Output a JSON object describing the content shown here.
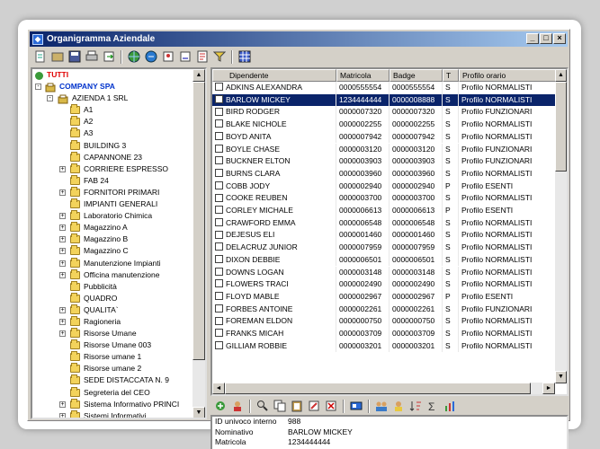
{
  "window": {
    "title": "Organigramma Aziendale"
  },
  "tree": {
    "root": "TUTTI",
    "company": "COMPANY SPA",
    "division": "AZIENDA 1 SRL",
    "nodes": [
      {
        "label": "A1",
        "expandable": false
      },
      {
        "label": "A2",
        "expandable": false
      },
      {
        "label": "A3",
        "expandable": false
      },
      {
        "label": "BUILDING 3",
        "expandable": false
      },
      {
        "label": "CAPANNONE 23",
        "expandable": false
      },
      {
        "label": "CORRIERE ESPRESSO",
        "expandable": true
      },
      {
        "label": "FAB 24",
        "expandable": false
      },
      {
        "label": "FORNITORI PRIMARI",
        "expandable": true
      },
      {
        "label": "IMPIANTI GENERALI",
        "expandable": false
      },
      {
        "label": "Laboratorio Chimica",
        "expandable": true
      },
      {
        "label": "Magazzino A",
        "expandable": true
      },
      {
        "label": "Magazzino B",
        "expandable": true
      },
      {
        "label": "Magazzino C",
        "expandable": true
      },
      {
        "label": "Manutenzione Impianti",
        "expandable": true
      },
      {
        "label": "Officina manutenzione",
        "expandable": true
      },
      {
        "label": "Pubblicità",
        "expandable": false
      },
      {
        "label": "QUADRO",
        "expandable": false
      },
      {
        "label": "QUALITA`",
        "expandable": true
      },
      {
        "label": "Ragioneria",
        "expandable": true
      },
      {
        "label": "Risorse Umane",
        "expandable": true
      },
      {
        "label": "Risorse Umane 003",
        "expandable": false
      },
      {
        "label": "Risorse umane 1",
        "expandable": false
      },
      {
        "label": "Risorse umane 2",
        "expandable": false
      },
      {
        "label": "SEDE DISTACCATA N. 9",
        "expandable": false
      },
      {
        "label": "Segreteria del CEO",
        "expandable": false
      },
      {
        "label": "Sistema Informativo PRINCI",
        "expandable": true
      },
      {
        "label": "Sistemi Informativi",
        "expandable": true
      }
    ]
  },
  "grid": {
    "columns": [
      "Dipendente",
      "Matricola",
      "Badge",
      "T",
      "Profilo orario"
    ],
    "rows": [
      {
        "name": "ADKINS ALEXANDRA",
        "matricola": "0000555554",
        "badge": "0000555554",
        "t": "S",
        "profilo": "Profilo NORMALISTI",
        "selected": false
      },
      {
        "name": "BARLOW MICKEY",
        "matricola": "1234444444",
        "badge": "0000008888",
        "t": "S",
        "profilo": "Profilo NORMALISTI",
        "selected": true
      },
      {
        "name": "BIRD RODGER",
        "matricola": "0000007320",
        "badge": "0000007320",
        "t": "S",
        "profilo": "Profilo FUNZIONARI",
        "selected": false
      },
      {
        "name": "BLAKE NICHOLE",
        "matricola": "0000002255",
        "badge": "0000002255",
        "t": "S",
        "profilo": "Profilo NORMALISTI",
        "selected": false
      },
      {
        "name": "BOYD ANITA",
        "matricola": "0000007942",
        "badge": "0000007942",
        "t": "S",
        "profilo": "Profilo NORMALISTI",
        "selected": false
      },
      {
        "name": "BOYLE CHASE",
        "matricola": "0000003120",
        "badge": "0000003120",
        "t": "S",
        "profilo": "Profilo FUNZIONARI",
        "selected": false
      },
      {
        "name": "BUCKNER ELTON",
        "matricola": "0000003903",
        "badge": "0000003903",
        "t": "S",
        "profilo": "Profilo FUNZIONARI",
        "selected": false
      },
      {
        "name": "BURNS CLARA",
        "matricola": "0000003960",
        "badge": "0000003960",
        "t": "S",
        "profilo": "Profilo NORMALISTI",
        "selected": false
      },
      {
        "name": "COBB JODY",
        "matricola": "0000002940",
        "badge": "0000002940",
        "t": "P",
        "profilo": "Profilo ESENTI",
        "selected": false
      },
      {
        "name": "COOKE REUBEN",
        "matricola": "0000003700",
        "badge": "0000003700",
        "t": "S",
        "profilo": "Profilo NORMALISTI",
        "selected": false
      },
      {
        "name": "CORLEY MICHALE",
        "matricola": "0000006613",
        "badge": "0000006613",
        "t": "P",
        "profilo": "Profilo ESENTI",
        "selected": false
      },
      {
        "name": "CRAWFORD EMMA",
        "matricola": "0000006548",
        "badge": "0000006548",
        "t": "S",
        "profilo": "Profilo NORMALISTI",
        "selected": false
      },
      {
        "name": "DEJESUS ELI",
        "matricola": "0000001460",
        "badge": "0000001460",
        "t": "S",
        "profilo": "Profilo NORMALISTI",
        "selected": false
      },
      {
        "name": "DELACRUZ JUNIOR",
        "matricola": "0000007959",
        "badge": "0000007959",
        "t": "S",
        "profilo": "Profilo NORMALISTI",
        "selected": false
      },
      {
        "name": "DIXON DEBBIE",
        "matricola": "0000006501",
        "badge": "0000006501",
        "t": "S",
        "profilo": "Profilo NORMALISTI",
        "selected": false
      },
      {
        "name": "DOWNS LOGAN",
        "matricola": "0000003148",
        "badge": "0000003148",
        "t": "S",
        "profilo": "Profilo NORMALISTI",
        "selected": false
      },
      {
        "name": "FLOWERS TRACI",
        "matricola": "0000002490",
        "badge": "0000002490",
        "t": "S",
        "profilo": "Profilo NORMALISTI",
        "selected": false
      },
      {
        "name": "FLOYD MABLE",
        "matricola": "0000002967",
        "badge": "0000002967",
        "t": "P",
        "profilo": "Profilo ESENTI",
        "selected": false
      },
      {
        "name": "FORBES ANTOINE",
        "matricola": "0000002261",
        "badge": "0000002261",
        "t": "S",
        "profilo": "Profilo FUNZIONARI",
        "selected": false
      },
      {
        "name": "FOREMAN ELDON",
        "matricola": "0000000750",
        "badge": "0000000750",
        "t": "S",
        "profilo": "Profilo NORMALISTI",
        "selected": false
      },
      {
        "name": "FRANKS MICAH",
        "matricola": "0000003709",
        "badge": "0000003709",
        "t": "S",
        "profilo": "Profilo NORMALISTI",
        "selected": false
      },
      {
        "name": "GILLIAM ROBBIE",
        "matricola": "0000003201",
        "badge": "0000003201",
        "t": "S",
        "profilo": "Profilo NORMALISTI",
        "selected": false
      }
    ]
  },
  "detail": {
    "id_label": "ID univoco interno",
    "id_value": "988",
    "name_label": "Nominativo",
    "name_value": "BARLOW MICKEY",
    "matricola_label": "Matricola",
    "matricola_value": "1234444444"
  },
  "icons": {
    "toolbar": [
      "new-icon",
      "open-icon",
      "save-icon",
      "print-icon",
      "export-icon",
      "globe-icon",
      "globe-refresh-icon",
      "users-icon",
      "user-icon",
      "report-icon",
      "filter-icon",
      "grid-icon"
    ],
    "bottom_toolbar": [
      "add-icon",
      "user-menu-icon",
      "find-icon",
      "copy-icon",
      "paste-icon",
      "edit-icon",
      "delete-icon",
      "card-icon",
      "team-icon",
      "group-icon",
      "sort-icon",
      "sum-icon",
      "stats-icon"
    ]
  },
  "colors": {
    "selection": "#0a246a",
    "title_start": "#0a246a",
    "title_end": "#a6caf0",
    "root_text": "#e00000",
    "company_text": "#0033cc"
  }
}
